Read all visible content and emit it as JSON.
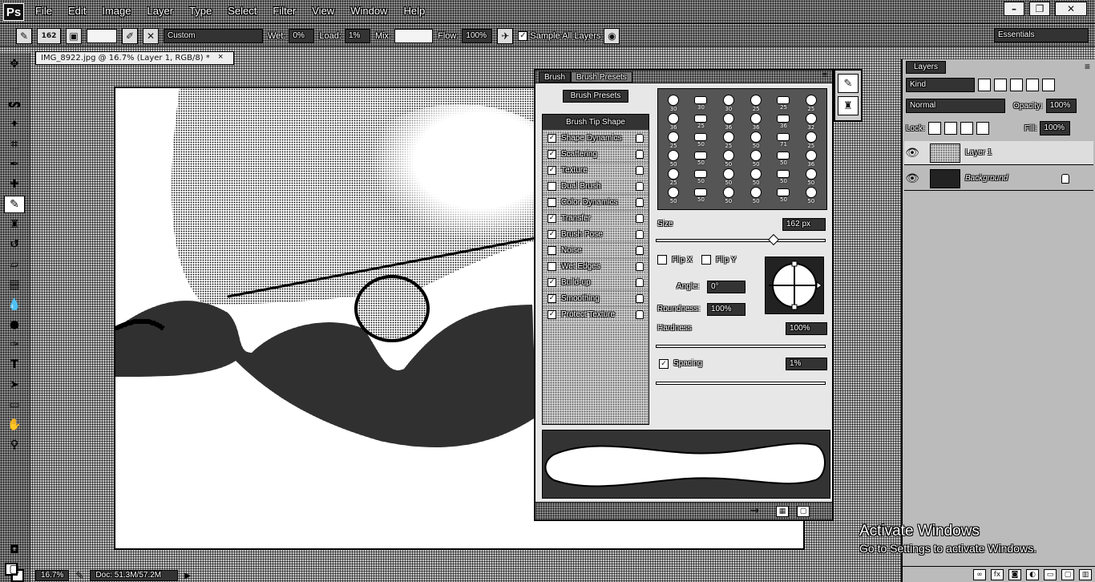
{
  "app": {
    "logo": "Ps",
    "menus": [
      "File",
      "Edit",
      "Image",
      "Layer",
      "Type",
      "Select",
      "Filter",
      "View",
      "Window",
      "Help"
    ],
    "window_controls": [
      "–",
      "❐",
      "✕"
    ],
    "workspace": "Essentials"
  },
  "options": {
    "brush_size": "162",
    "mode": "Custom",
    "wet_label": "Wet:",
    "wet_value": "0%",
    "load_label": "Load:",
    "load_value": "1%",
    "mix_label": "Mix:",
    "mix_value": "",
    "flow_label": "Flow:",
    "flow_value": "100%",
    "sample_all_layers": "Sample All Layers"
  },
  "document": {
    "tab_title": "IMG_8922.jpg @ 16.7% (Layer 1, RGB/8) *",
    "close": "×"
  },
  "status": {
    "zoom": "16.7%",
    "doc": "Doc: 51.3M/57.2M"
  },
  "brush_panel": {
    "tabs": [
      "Brush",
      "Brush Presets"
    ],
    "presets_button": "Brush Presets",
    "settings_header": "Brush Tip Shape",
    "settings": [
      {
        "label": "Shape Dynamics",
        "checked": true
      },
      {
        "label": "Scattering",
        "checked": true
      },
      {
        "label": "Texture",
        "checked": true
      },
      {
        "label": "Dual Brush",
        "checked": false
      },
      {
        "label": "Color Dynamics",
        "checked": false
      },
      {
        "label": "Transfer",
        "checked": true
      },
      {
        "label": "Brush Pose",
        "checked": true
      },
      {
        "label": "Noise",
        "checked": false
      },
      {
        "label": "Wet Edges",
        "checked": false
      },
      {
        "label": "Build-up",
        "checked": true
      },
      {
        "label": "Smoothing",
        "checked": true
      },
      {
        "label": "Protect Texture",
        "checked": true
      }
    ],
    "tip_sizes": [
      "30",
      "30",
      "30",
      "25",
      "25",
      "25",
      "36",
      "25",
      "36",
      "36",
      "36",
      "32",
      "25",
      "50",
      "25",
      "50",
      "71",
      "25",
      "50",
      "50",
      "50",
      "50",
      "50",
      "36",
      "25",
      "50",
      "50",
      "50",
      "50",
      "50",
      "50",
      "50",
      "50",
      "50",
      "50",
      "50"
    ],
    "size_label": "Size",
    "size_value": "162 px",
    "flip_x": "Flip X",
    "flip_y": "Flip Y",
    "angle_label": "Angle:",
    "angle_value": "0°",
    "roundness_label": "Roundness:",
    "roundness_value": "100%",
    "hardness_label": "Hardness",
    "hardness_value": "100%",
    "spacing_label": "Spacing",
    "spacing_value": "1%"
  },
  "layers_panel": {
    "tab": "Layers",
    "kind": "Kind",
    "blend_mode": "Normal",
    "opacity_label": "Opacity:",
    "opacity_value": "100%",
    "lock_label": "Lock:",
    "fill_label": "Fill:",
    "fill_value": "100%",
    "layers": [
      {
        "name": "Layer 1",
        "selected": true
      },
      {
        "name": "Background",
        "selected": false
      }
    ],
    "footer_icons": [
      "link-icon",
      "fx-icon",
      "mask-icon",
      "adjustment-icon",
      "folder-icon",
      "new-layer-icon",
      "trash-icon"
    ]
  },
  "watermark": {
    "title": "Activate Windows",
    "subtitle": "Go to Settings to activate Windows."
  }
}
